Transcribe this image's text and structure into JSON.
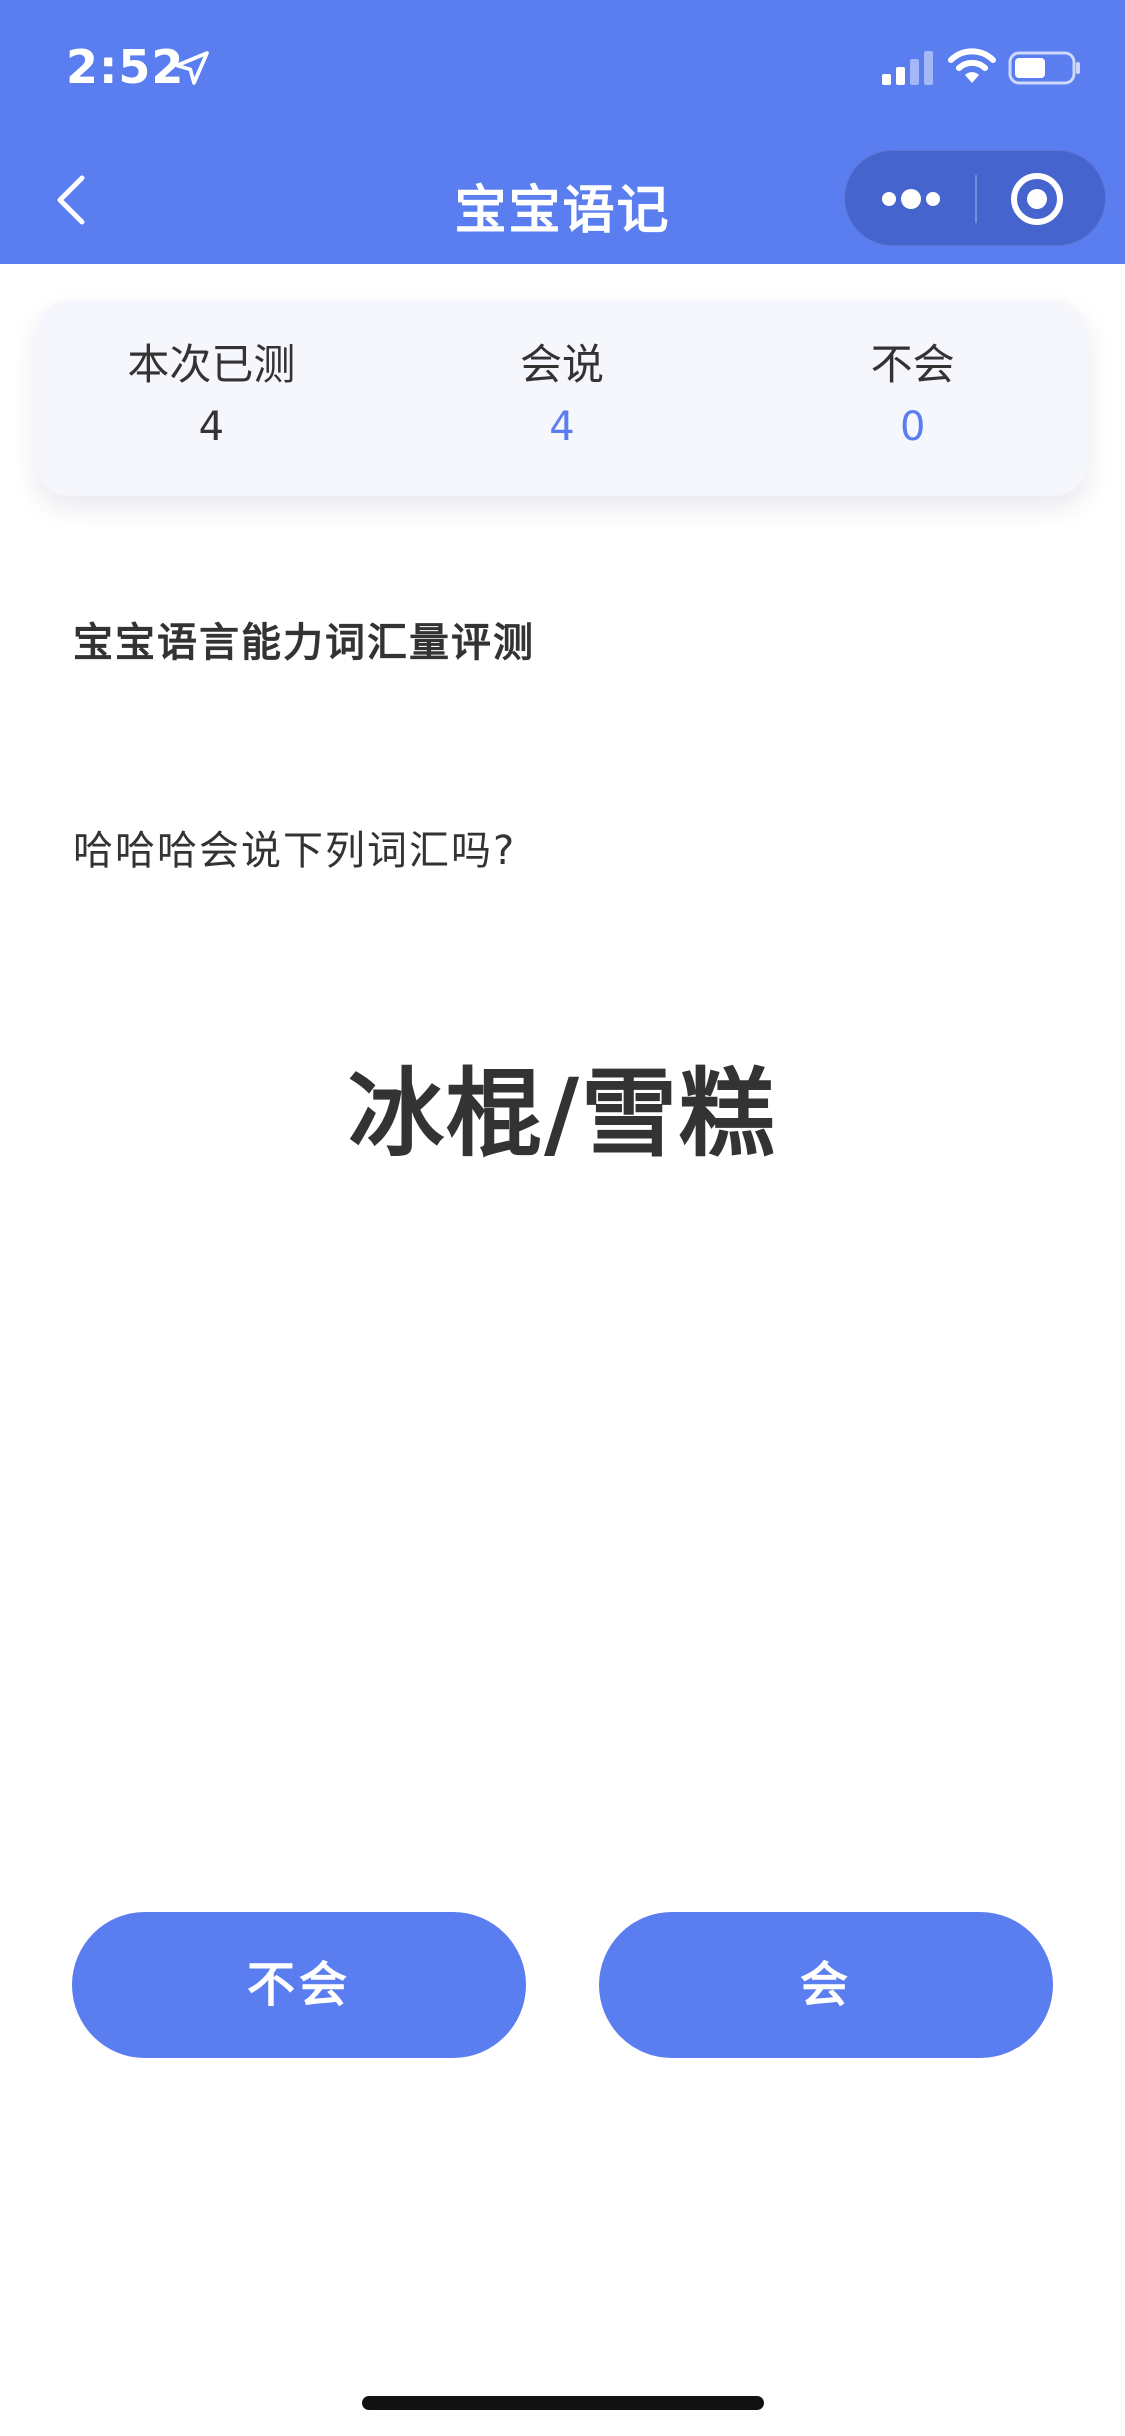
{
  "status_bar": {
    "time": "2:52",
    "icons": [
      "location-arrow-icon",
      "cellular-signal-icon",
      "wifi-icon",
      "battery-icon"
    ]
  },
  "nav": {
    "title": "宝宝语记",
    "back_icon": "chevron-left-icon",
    "more_icon": "more-dots-icon",
    "close_icon": "target-circle-icon"
  },
  "stats": {
    "tested_label": "本次已测",
    "tested_value": "4",
    "can_label": "会说",
    "can_value": "4",
    "cannot_label": "不会",
    "cannot_value": "0"
  },
  "content": {
    "section_title": "宝宝语言能力词汇量评测",
    "question": "哈哈哈会说下列词汇吗?",
    "word": "冰棍/雪糕"
  },
  "actions": {
    "no_label": "不会",
    "yes_label": "会"
  },
  "colors": {
    "primary": "#5a7df0",
    "text": "#333333",
    "card_bg": "#f6f7fc"
  }
}
